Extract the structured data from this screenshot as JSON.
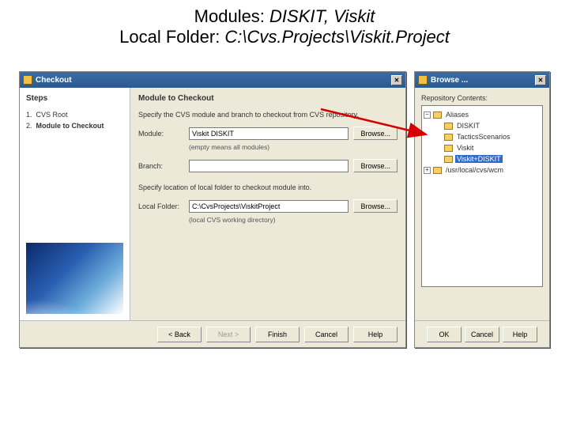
{
  "slide": {
    "modules_label": "Modules: ",
    "modules_value": "DISKIT, Viskit",
    "localfolder_label": "Local Folder:  ",
    "localfolder_value": "C:\\Cvs.Projects\\Viskit.Project"
  },
  "checkout": {
    "title": "Checkout",
    "steps_heading": "Steps",
    "steps": {
      "s1_num": "1.",
      "s1_label": "CVS Root",
      "s2_num": "2.",
      "s2_label": "Module to Checkout"
    },
    "heading": "Module to Checkout",
    "desc": "Specify the CVS module and branch to checkout from CVS repository.",
    "module_label": "Module:",
    "module_value": "Viskit DISKIT",
    "module_hint": "(empty means all modules)",
    "branch_label": "Branch:",
    "branch_value": "",
    "spec_local": "Specify location of local folder to checkout module into.",
    "localfolder_label": "Local Folder:",
    "localfolder_value": "C:\\CvsProjects\\ViskitProject",
    "localfolder_hint": "(local CVS working directory)",
    "browse_btn": "Browse...",
    "buttons": {
      "back": "< Back",
      "next": "Next >",
      "finish": "Finish",
      "cancel": "Cancel",
      "help": "Help"
    }
  },
  "browse": {
    "title": "Browse ...",
    "label": "Repository Contents:",
    "tree": {
      "aliases": "Aliases",
      "diskit": "DISKIT",
      "tactics": "TacticsScenarios",
      "viskit": "Viskit",
      "combo": "Viskit+DISKIT",
      "usr": "/usr/local/cvs/wcm"
    },
    "buttons": {
      "ok": "OK",
      "cancel": "Cancel",
      "help": "Help"
    }
  }
}
